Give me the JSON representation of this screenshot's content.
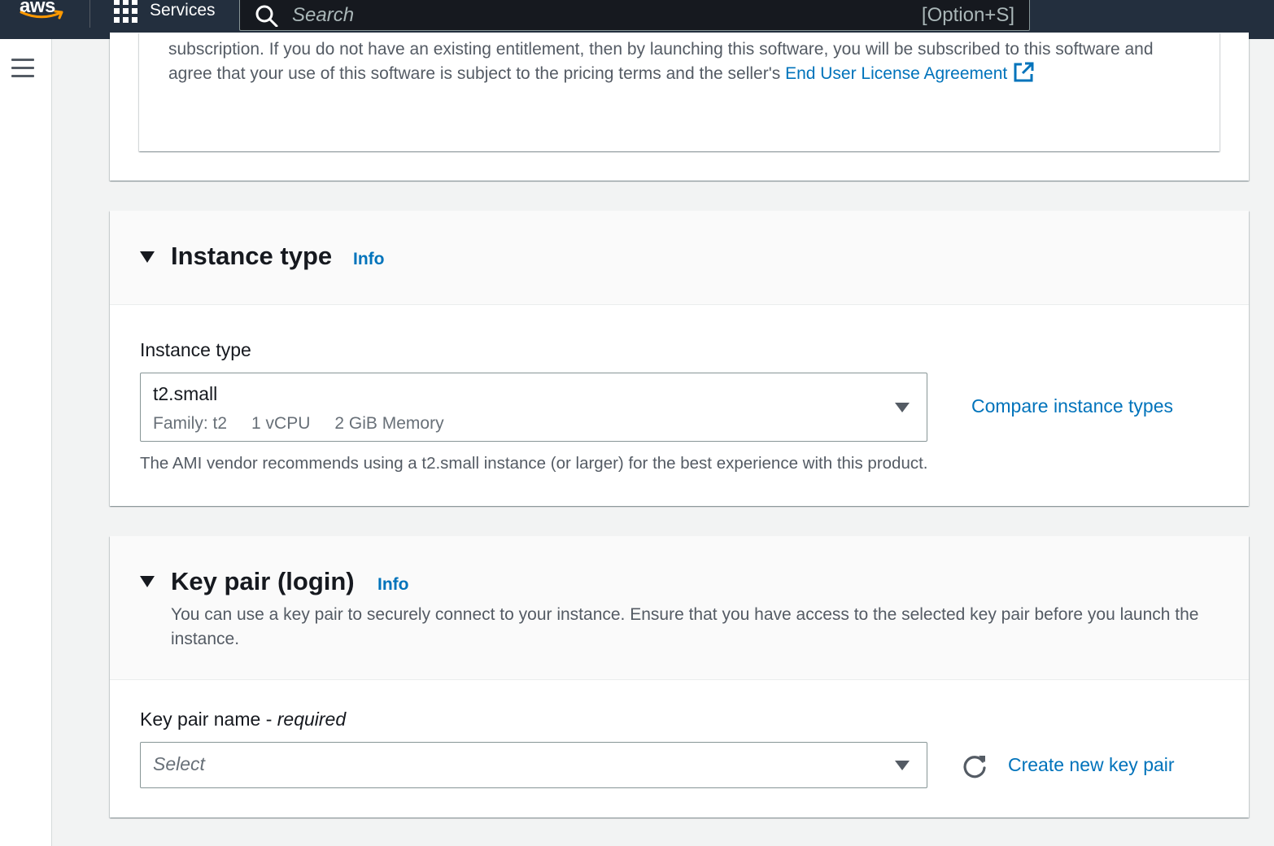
{
  "nav": {
    "logo_text": "aws",
    "services_label": "Services",
    "search_placeholder": "Search",
    "search_shortcut": "[Option+S]"
  },
  "software_panel": {
    "text": "subscription. If you do not have an existing entitlement, then by launching this software, you will be subscribed to this software and agree that your use of this software is subject to the pricing terms and the seller's ",
    "eula_link": "End User License Agreement"
  },
  "instance_type": {
    "title": "Instance type",
    "info": "Info",
    "field_label": "Instance type",
    "selected": {
      "name": "t2.small",
      "family": "Family: t2",
      "vcpu": "1 vCPU",
      "memory": "2 GiB Memory"
    },
    "compare_link": "Compare instance types",
    "recommendation": "The AMI vendor recommends using a t2.small instance (or larger) for the best experience with this product."
  },
  "key_pair": {
    "title": "Key pair (login)",
    "info": "Info",
    "description": "You can use a key pair to securely connect to your instance. Ensure that you have access to the selected key pair before you launch the instance.",
    "field_label": "Key pair name - ",
    "field_required": "required",
    "placeholder": "Select",
    "create_link": "Create new key pair"
  },
  "colors": {
    "nav_bg": "#232f3e",
    "link": "#0073bb",
    "page_bg": "#f2f3f3",
    "smile": "#ff9900"
  },
  "icons": [
    "aws-logo",
    "grid-icon",
    "search-icon",
    "hamburger-icon",
    "external-link-icon",
    "caret-down-icon",
    "refresh-icon"
  ]
}
